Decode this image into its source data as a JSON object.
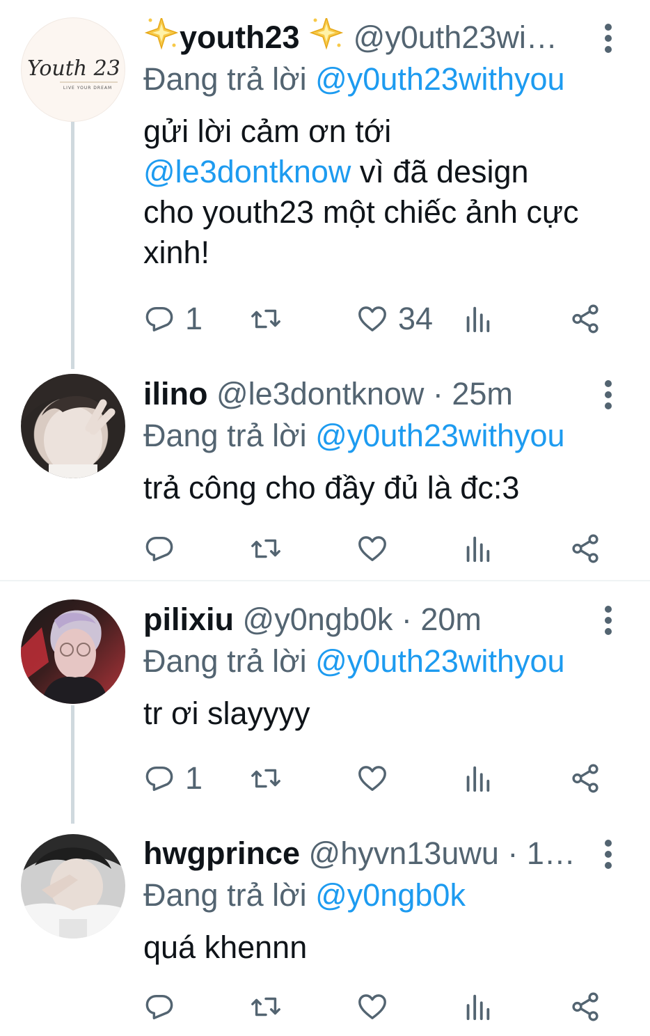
{
  "replying_prefix": "Đang trả lời",
  "tweets": [
    {
      "name": "youth23",
      "handle": "@y0uth23wi…",
      "time": "",
      "replying_to": "@y0uth23withyou",
      "avatar_text": "Youth 23",
      "avatar_subtext": "LIVE YOUR DREAM",
      "body": {
        "line1": "gửi lời cảm ơn tới",
        "mention": "@le3dontknow",
        "after_mention": " vì đã design",
        "line3": "cho youth23 một chiếc ảnh cực",
        "line4": "xinh!"
      },
      "replies": "1",
      "retweets": "",
      "likes": "34"
    },
    {
      "name": "ilino",
      "handle": "@le3dontknow",
      "time": "· 25m",
      "replying_to": "@y0uth23withyou",
      "body": "trả công cho đầy đủ là đc:3",
      "replies": "",
      "retweets": "",
      "likes": ""
    },
    {
      "name": "pilixiu",
      "handle": "@y0ngb0k",
      "time": "· 20m",
      "replying_to": "@y0uth23withyou",
      "body": "tr ơi slayyyy",
      "replies": "1",
      "retweets": "",
      "likes": ""
    },
    {
      "name": "hwgprince",
      "handle": "@hyvn13uwu",
      "time": "· 1…",
      "replying_to": "@y0ngb0k",
      "body": "quá khennn",
      "replies": "",
      "retweets": "",
      "likes": ""
    }
  ],
  "icons": {
    "reply": "reply-icon",
    "retweet": "retweet-icon",
    "like": "heart-icon",
    "views": "views-icon",
    "share": "share-icon",
    "more": "more-options-icon",
    "sparkle": "sparkle-emoji"
  },
  "colors": {
    "text": "#0f1419",
    "secondary": "#536471",
    "link": "#1d9bf0",
    "thread_line": "#cfd9de",
    "divider": "#eff3f4"
  }
}
